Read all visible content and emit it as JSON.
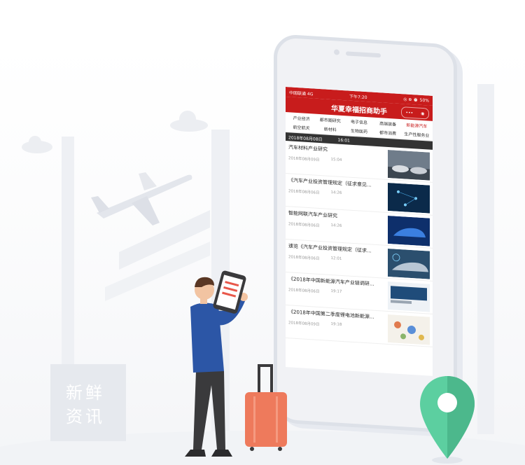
{
  "app": {
    "title": "华夏幸福招商助手",
    "status_left": "中国联通  4G",
    "status_center": "下午7:20",
    "status_right": "◎ ⊕ ⏰ 50%",
    "capsule_more": "•••",
    "capsule_close": "◉"
  },
  "tabs": [
    {
      "label": "产业经济",
      "active": false
    },
    {
      "label": "都市圈研究",
      "active": false
    },
    {
      "label": "电子信息",
      "active": false
    },
    {
      "label": "高端装备",
      "active": false
    },
    {
      "label": "新能源汽车",
      "active": true
    },
    {
      "label": "航空航天",
      "active": false
    },
    {
      "label": "新材料",
      "active": false
    },
    {
      "label": "生物医药",
      "active": false
    },
    {
      "label": "都市消费",
      "active": false
    },
    {
      "label": "生产性服务业",
      "active": false
    }
  ],
  "banner": {
    "date": "2018年08月08日",
    "time": "16:01"
  },
  "articles": [
    {
      "title": "汽车材料产业研究",
      "date": "2018年08月09日",
      "time": "15:04",
      "thumb": "car-showroom"
    },
    {
      "title": "《汽车产业投资管理规定（征求意见...",
      "date": "2018年08月06日",
      "time": "14:26",
      "thumb": "network-tech"
    },
    {
      "title": "智能网联汽车产业研究",
      "date": "2018年08月06日",
      "time": "14:26",
      "thumb": "blue-car"
    },
    {
      "title": "速览《汽车产业投资管理规定（征求...",
      "date": "2018年08月06日",
      "time": "12:01",
      "thumb": "car-hud"
    },
    {
      "title": "《2018年中国新能源汽车产业链调研...",
      "date": "2018年08月06日",
      "time": "19:17",
      "thumb": "ev-charge"
    },
    {
      "title": "《2018年中国第二季度锂电池新能源...",
      "date": "2018年08月09日",
      "time": "19:18",
      "thumb": "battery-map"
    }
  ],
  "sign": {
    "line1": "新鲜",
    "line2": "资讯"
  },
  "colors": {
    "brand_red": "#c81c1c",
    "pin_green": "#5ccfa0",
    "luggage": "#ee7a5c",
    "shirt": "#2c56a6"
  }
}
